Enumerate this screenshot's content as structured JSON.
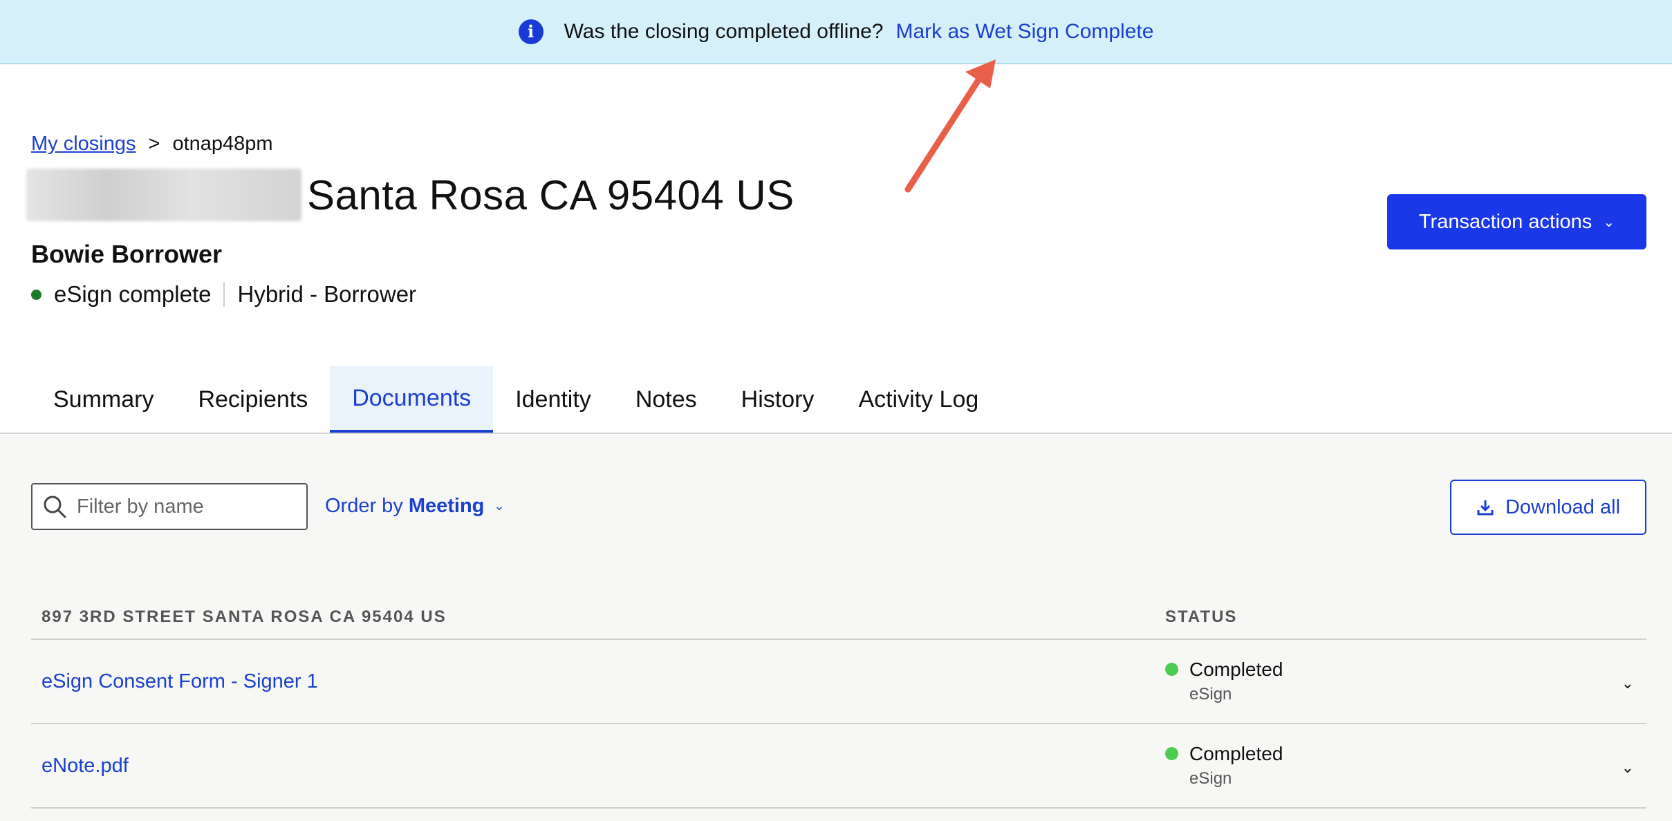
{
  "banner": {
    "text": "Was the closing completed offline?",
    "link": "Mark as Wet Sign Complete"
  },
  "breadcrumb": {
    "root": "My closings",
    "separator": ">",
    "current": "otnap48pm"
  },
  "header": {
    "title": "Santa Rosa CA 95404 US",
    "borrower": "Bowie Borrower",
    "status": "eSign complete",
    "type": "Hybrid - Borrower",
    "actions_label": "Transaction actions"
  },
  "tabs": [
    {
      "label": "Summary"
    },
    {
      "label": "Recipients"
    },
    {
      "label": "Documents"
    },
    {
      "label": "Identity"
    },
    {
      "label": "Notes"
    },
    {
      "label": "History"
    },
    {
      "label": "Activity Log"
    }
  ],
  "toolbar": {
    "search_placeholder": "Filter by name",
    "order_prefix": "Order by",
    "order_value": "Meeting",
    "download_label": "Download all"
  },
  "table": {
    "col_address": "897 3RD STREET SANTA ROSA CA 95404 US",
    "col_status": "STATUS",
    "rows": [
      {
        "name": "eSign Consent Form - Signer 1",
        "status": "Completed",
        "method": "eSign"
      },
      {
        "name": "eNote.pdf",
        "status": "Completed",
        "method": "eSign"
      }
    ]
  },
  "colors": {
    "accent": "#1b40cf",
    "button": "#1b38e8",
    "banner_bg": "#d6f0fa",
    "status_complete": "#4ccd52",
    "annotation_arrow": "#e8604a"
  }
}
